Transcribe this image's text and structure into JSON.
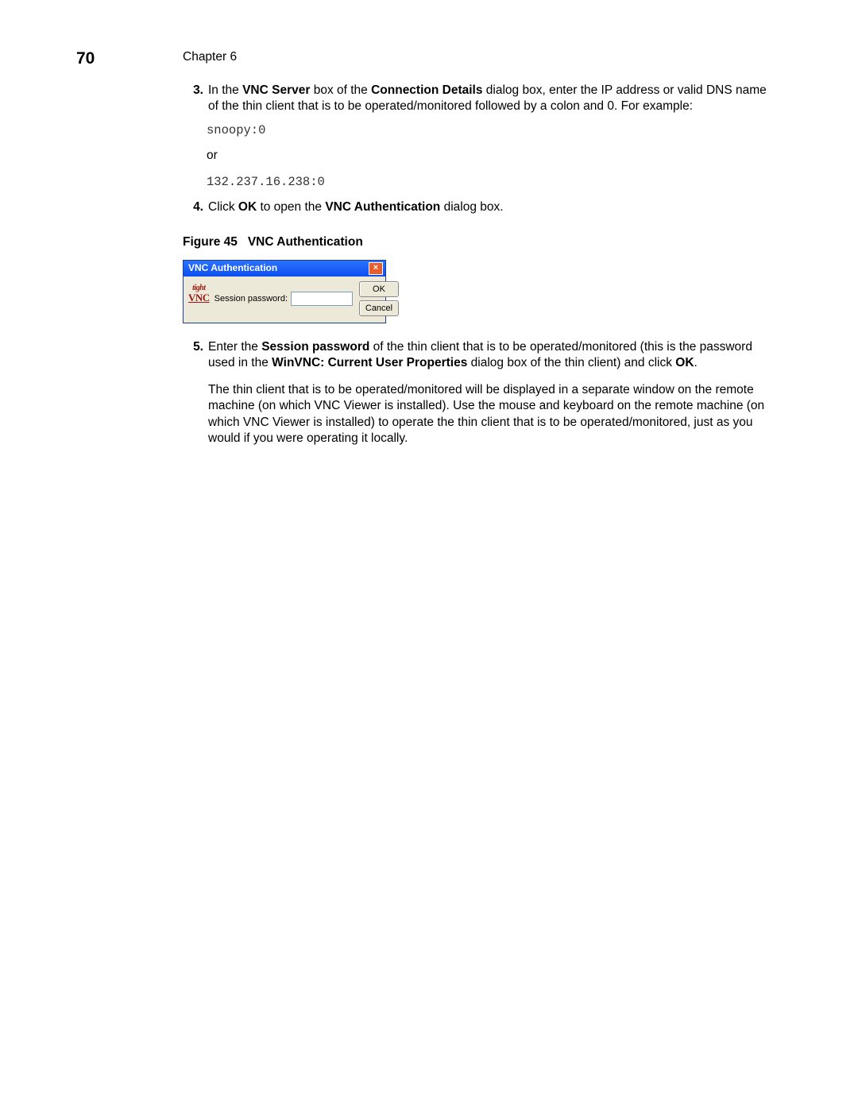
{
  "page_number": "70",
  "chapter": "Chapter 6",
  "step3": {
    "num": "3.",
    "t0": "In the ",
    "b0": "VNC Server",
    "t1": " box of the ",
    "b1": "Connection Details",
    "t2": " dialog box, enter the IP address or valid DNS name of the thin client that is to be operated/monitored followed by a colon and 0. For example:",
    "ex1": "snoopy:0",
    "or": "or",
    "ex2": "132.237.16.238:0"
  },
  "step4": {
    "num": "4.",
    "t0": "Click ",
    "b0": "OK",
    "t1": " to open the ",
    "b1": "VNC Authentication",
    "t2": " dialog box."
  },
  "figure": {
    "label": "Figure 45",
    "title": "VNC Authentication"
  },
  "dialog": {
    "title": "VNC Authentication",
    "close_glyph": "×",
    "logo_top": "tight",
    "logo_bot": "VNC",
    "label": "Session password:",
    "value": "",
    "ok": "OK",
    "cancel": "Cancel"
  },
  "step5": {
    "num": "5.",
    "t0": "Enter the ",
    "b0": "Session password",
    "t1": " of the thin client that is to be operated/monitored (this is the password used in the ",
    "b1": "WinVNC: Current User Properties",
    "t2": " dialog box of the thin client) and click ",
    "b2": "OK",
    "t3": ".",
    "p2": "The thin client that is to be operated/monitored will be displayed in a separate window on the remote machine (on which VNC Viewer is installed). Use the mouse and keyboard on the remote machine (on which VNC Viewer is installed) to operate the thin client that is to be operated/monitored, just as you would if you were operating it locally."
  }
}
